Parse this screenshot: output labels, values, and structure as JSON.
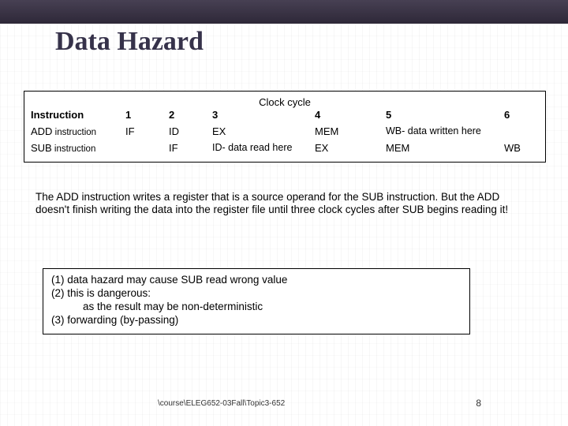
{
  "title": "Data Hazard",
  "table": {
    "clock_label": "Clock cycle",
    "headers": [
      "Instruction",
      "1",
      "2",
      "3",
      "4",
      "5",
      "6"
    ],
    "rows": [
      {
        "instr_prefix": "ADD",
        "instr_suffix": " instruction",
        "c1": "IF",
        "c2": "ID",
        "c3": "EX",
        "c4": "MEM",
        "c5": "WB- data written here",
        "c6": ""
      },
      {
        "instr_prefix": "SUB",
        "instr_suffix": " instruction",
        "c1": "",
        "c2": "IF",
        "c3": "ID- data read here",
        "c4": "EX",
        "c5": "MEM",
        "c6": "WB"
      }
    ]
  },
  "paragraph": "The ADD instruction writes a register that is a source operand for the SUB instruction. But the ADD doesn't finish writing the data into the register file until three clock cycles after SUB begins reading it!",
  "points": {
    "p1": "(1)  data hazard may cause SUB read wrong value",
    "p2": "(2)  this is dangerous:",
    "p2b": "as the result may be non-deterministic",
    "p3": "(3)  forwarding (by-passing)"
  },
  "footer": {
    "path": "\\course\\ELEG652-03Fall\\Topic3-652",
    "page": "8"
  },
  "chart_data": {
    "type": "table",
    "title": "Data Hazard pipeline timing",
    "columns": [
      "Instruction",
      "Cycle 1",
      "Cycle 2",
      "Cycle 3",
      "Cycle 4",
      "Cycle 5",
      "Cycle 6"
    ],
    "rows": [
      [
        "ADD instruction",
        "IF",
        "ID",
        "EX",
        "MEM",
        "WB (data written here)",
        ""
      ],
      [
        "SUB instruction",
        "",
        "IF",
        "ID (data read here)",
        "EX",
        "MEM",
        "WB"
      ]
    ]
  }
}
